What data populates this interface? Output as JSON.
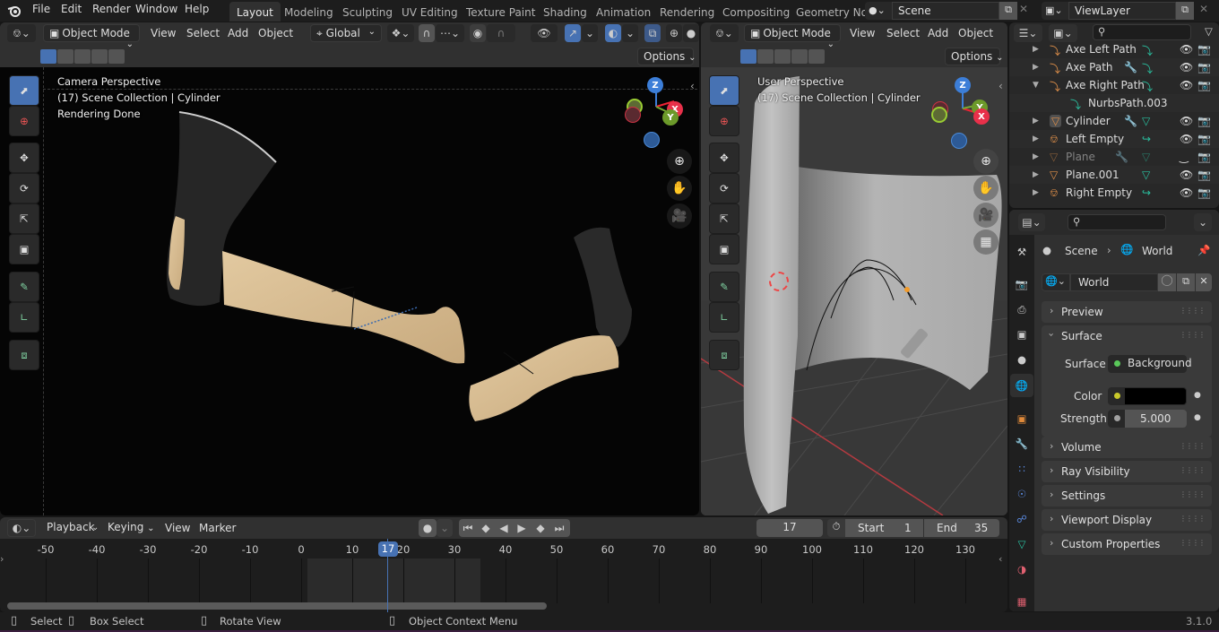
{
  "app": {
    "version": "3.1.0"
  },
  "topbar": {
    "menus": [
      "File",
      "Edit",
      "Render",
      "Window",
      "Help"
    ],
    "workspaces": [
      "Layout",
      "Modeling",
      "Sculpting",
      "UV Editing",
      "Texture Paint",
      "Shading",
      "Animation",
      "Rendering",
      "Compositing",
      "Geometry No"
    ],
    "active_workspace": "Layout",
    "scene": "Scene",
    "view_layer": "ViewLayer"
  },
  "viewport_left": {
    "mode": "Object Mode",
    "menus": [
      "View",
      "Select",
      "Add",
      "Object"
    ],
    "transform_orientation": "Global",
    "options_label": "Options",
    "overlay_lines": [
      "Camera Perspective",
      "(17) Scene Collection | Cylinder",
      "Rendering Done"
    ],
    "gizmo_axes": {
      "x": "X",
      "y": "Y",
      "z": "Z"
    }
  },
  "viewport_right": {
    "mode": "Object Mode",
    "menus": [
      "View",
      "Select",
      "Add",
      "Object"
    ],
    "options_label": "Options",
    "overlay_lines": [
      "User Perspective",
      "(17) Scene Collection | Cylinder"
    ],
    "gizmo_axes": {
      "x": "X",
      "y": "Y",
      "z": "Z"
    }
  },
  "outliner": {
    "search_placeholder": "",
    "items": [
      {
        "name": "Axe Left Path",
        "type": "curve",
        "expanded": false,
        "visible": true,
        "renderable": true
      },
      {
        "name": "Axe Path",
        "type": "curve",
        "expanded": false,
        "visible": true,
        "renderable": true,
        "modifier": true
      },
      {
        "name": "Axe Right Path",
        "type": "curve",
        "expanded": true,
        "visible": true,
        "renderable": true
      },
      {
        "name": "NurbsPath.003",
        "type": "curve-data",
        "child": true
      },
      {
        "name": "Cylinder",
        "type": "mesh",
        "expanded": false,
        "visible": true,
        "renderable": true,
        "modifier": true,
        "active": true
      },
      {
        "name": "Left Empty",
        "type": "empty",
        "expanded": false,
        "visible": true,
        "renderable": true
      },
      {
        "name": "Plane",
        "type": "mesh",
        "expanded": false,
        "visible": false,
        "renderable": true,
        "modifier": true,
        "dimmed": true
      },
      {
        "name": "Plane.001",
        "type": "mesh",
        "expanded": false,
        "visible": true,
        "renderable": true
      },
      {
        "name": "Right Empty",
        "type": "empty",
        "expanded": false,
        "visible": true,
        "renderable": true
      }
    ]
  },
  "properties": {
    "breadcrumb": [
      "Scene",
      "World"
    ],
    "world_name": "World",
    "panels": {
      "preview": "Preview",
      "surface": "Surface",
      "volume": "Volume",
      "ray_visibility": "Ray Visibility",
      "settings": "Settings",
      "viewport_display": "Viewport Display",
      "custom_properties": "Custom Properties"
    },
    "surface": {
      "surface_label": "Surface",
      "surface_value": "Background",
      "color_label": "Color",
      "color_value": "#000000",
      "strength_label": "Strength",
      "strength_value": "5.000"
    }
  },
  "timeline": {
    "menus": [
      "Playback",
      "Keying",
      "View",
      "Marker"
    ],
    "current_frame": "17",
    "start_label": "Start",
    "start": "1",
    "end_label": "End",
    "end": "35",
    "ticks": [
      "-50",
      "-40",
      "-30",
      "-20",
      "-10",
      "0",
      "10",
      "20",
      "30",
      "40",
      "50",
      "60",
      "70",
      "80",
      "90",
      "100",
      "110",
      "120",
      "130"
    ],
    "playhead_label": "17"
  },
  "statusbar": {
    "items": [
      "Select",
      "Box Select",
      "Rotate View",
      "Object Context Menu"
    ],
    "version": "3.1.0"
  }
}
